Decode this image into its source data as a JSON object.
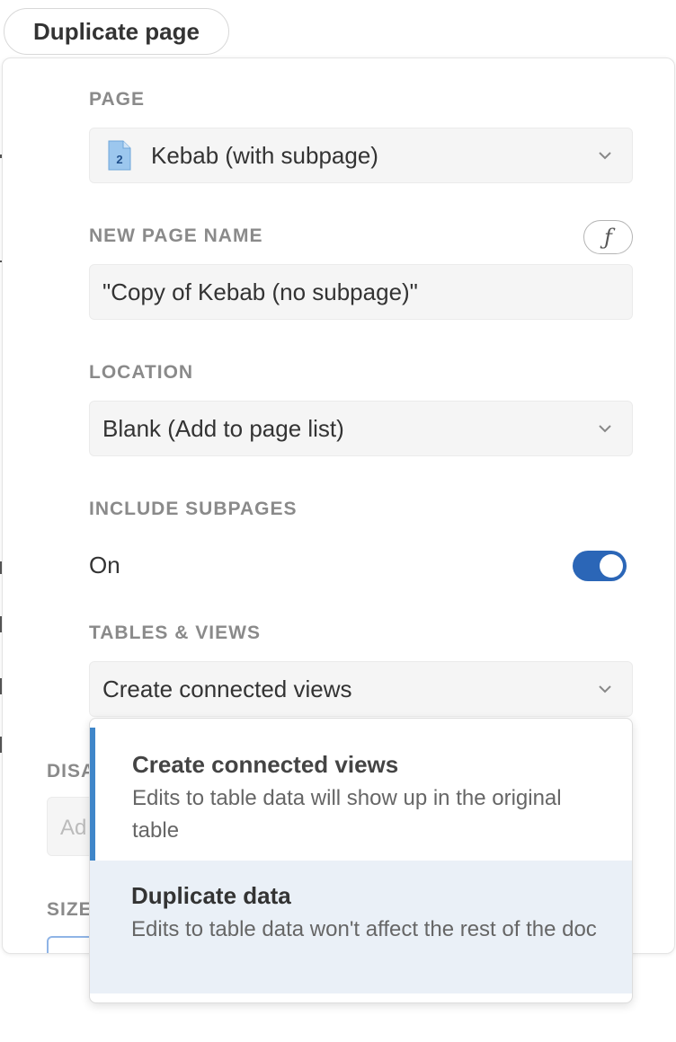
{
  "header": {
    "button_label": "Duplicate page"
  },
  "form": {
    "page": {
      "label": "PAGE",
      "value": "Kebab (with subpage)",
      "icon": "document-icon",
      "icon_number": "2"
    },
    "new_page_name": {
      "label": "NEW PAGE NAME",
      "value": "\"Copy of Kebab (no subpage)\"",
      "formula_button": "ƒ"
    },
    "location": {
      "label": "LOCATION",
      "value": "Blank (Add to page list)"
    },
    "include_subpages": {
      "label": "INCLUDE SUBPAGES",
      "state_label": "On",
      "enabled": true
    },
    "tables_views": {
      "label": "TABLES & VIEWS",
      "value": "Create connected views"
    }
  },
  "dropdown": {
    "options": [
      {
        "title": "Create connected views",
        "description": "Edits to table data will show up in the original table",
        "selected": true
      },
      {
        "title": "Duplicate data",
        "description": "Edits to table data won't affect the rest of the doc",
        "highlighted": true
      }
    ]
  },
  "background": {
    "label_1": "DISA",
    "input_placeholder": "Ad",
    "label_2": "SIZE"
  },
  "colors": {
    "toggle_on": "#2b66b7",
    "selected_bar": "#3f86c9",
    "highlight_bg": "#eaf0f7"
  }
}
